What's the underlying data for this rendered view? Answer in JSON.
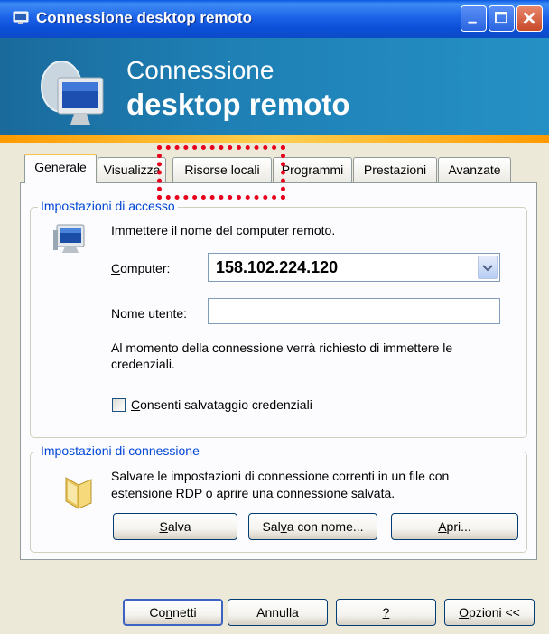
{
  "window": {
    "title": "Connessione desktop remoto"
  },
  "banner": {
    "line1": "Connessione",
    "line2": "desktop remoto"
  },
  "tabs": [
    {
      "label": "Generale",
      "active": true
    },
    {
      "label": "Visualizza",
      "active": false
    },
    {
      "label": "Risorse locali",
      "active": false
    },
    {
      "label": "Programmi",
      "active": false
    },
    {
      "label": "Prestazioni",
      "active": false
    },
    {
      "label": "Avanzate",
      "active": false
    }
  ],
  "access": {
    "group_label": "Impostazioni di accesso",
    "instruction": "Immettere il nome del computer remoto.",
    "computer_label": "Computer:",
    "computer_value": "158.102.224.120",
    "username_label": "Nome utente:",
    "username_value": "",
    "note_line1": "Al momento della connessione verrà richiesto di immettere le",
    "note_line2": "credenziali.",
    "save_credentials_label": "Consenti salvataggio credenziali",
    "save_credentials_checked": false
  },
  "connection": {
    "group_label": "Impostazioni di connessione",
    "desc_line1": "Salvare le impostazioni di connessione correnti in un file con",
    "desc_line2": "estensione RDP o aprire una connessione salvata.",
    "save_label": "Salva",
    "save_as_label": "Salva con nome...",
    "open_label": "Apri..."
  },
  "footer": {
    "connect_label": "Connetti",
    "cancel_label": "Annulla",
    "help_label": "?",
    "options_label": "Opzioni <<"
  },
  "colors": {
    "titlebar": "#0a57e0",
    "banner": "#1e7fb4",
    "accent_stripe": "#ff9a00",
    "highlight": "#e8001c",
    "group_label": "#0046d5"
  }
}
